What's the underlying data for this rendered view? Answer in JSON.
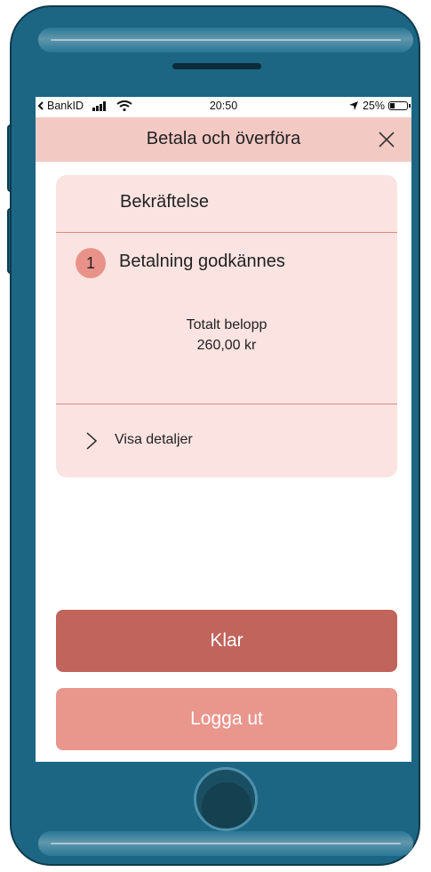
{
  "status_bar": {
    "carrier": "BankID",
    "time": "20:50",
    "battery": "25%"
  },
  "header": {
    "title": "Betala och överföra"
  },
  "confirmation": {
    "title": "Bekräftelse",
    "step_number": "1",
    "step_label": "Betalning godkännes",
    "total_label": "Totalt belopp",
    "total_value": "260,00 kr",
    "details_label": "Visa detaljer"
  },
  "buttons": {
    "done": "Klar",
    "logout": "Logga ut"
  },
  "colors": {
    "header_bg": "#f3c9c4",
    "card_bg": "#fae3e1",
    "primary_button": "#c0645c",
    "secondary_button": "#e9968d",
    "phone_body": "#1c6684"
  }
}
